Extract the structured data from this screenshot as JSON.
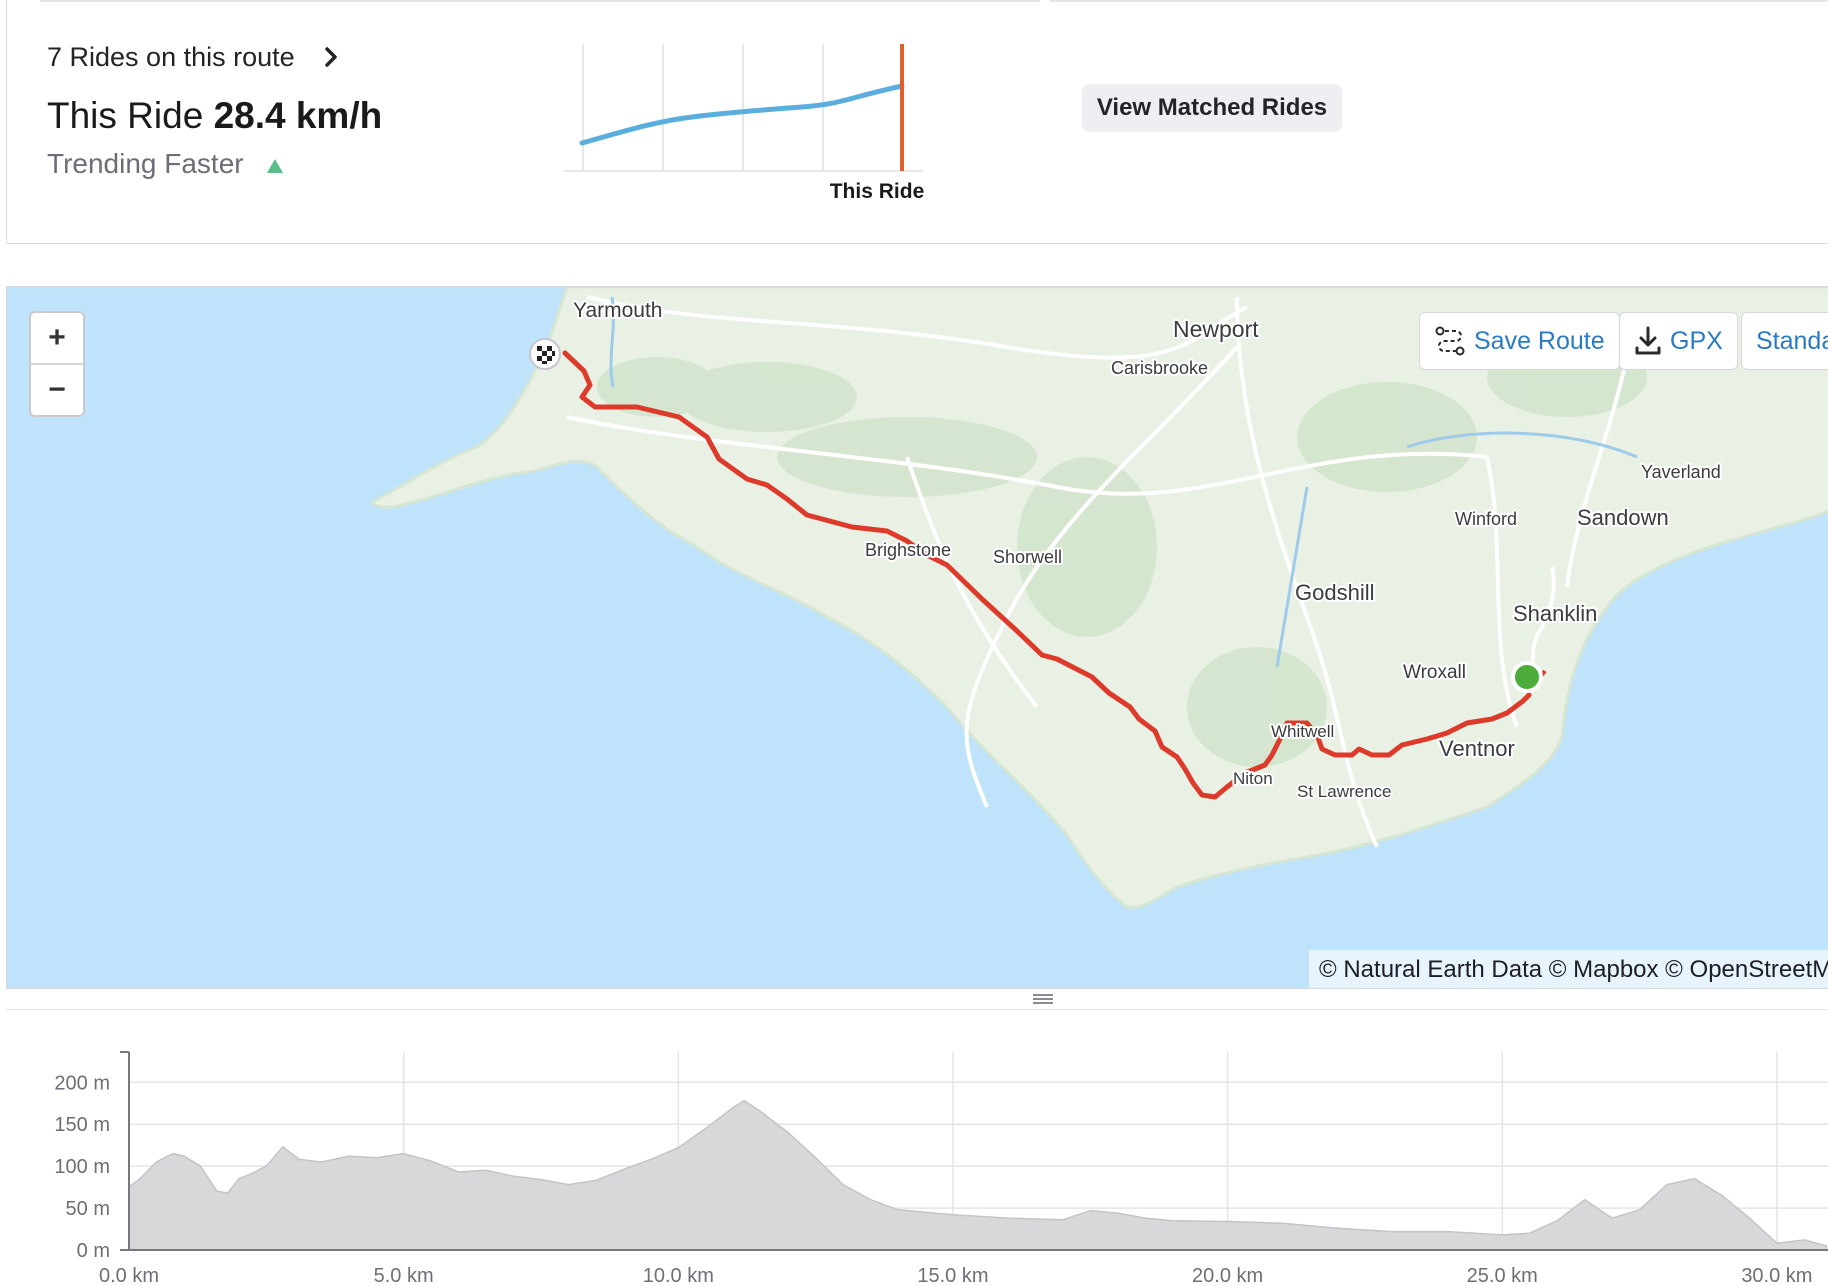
{
  "stats": {
    "rides_on_route": "7 Rides on this route",
    "this_ride_label": "This Ride",
    "this_ride_speed": "28.4 km/h",
    "trend_text": "Trending Faster",
    "trend_chart_label": "This Ride",
    "matched_button": "View Matched Rides",
    "trend_line_color": "#5aaede",
    "this_ride_marker_color": "#e0602b",
    "trend_up_color": "#5cbf8a"
  },
  "map": {
    "zoom_in": "+",
    "zoom_out": "−",
    "save_route": "Save Route",
    "gpx": "GPX",
    "standard": "Standard",
    "attribution": "© Natural Earth Data © Mapbox © OpenStreetMap",
    "route_color": "#de3a2c",
    "start_marker_color": "#4cad3a",
    "water_color": "#bfe3fa",
    "land_color": "#e8f1e4",
    "places": {
      "yarmouth": "Yarmouth",
      "newport": "Newport",
      "carisbrooke": "Carisbrooke",
      "yaverland": "Yaverland",
      "winford": "Winford",
      "sandown": "Sandown",
      "brighstone": "Brighstone",
      "shorwell": "Shorwell",
      "godshill": "Godshill",
      "shanklin": "Shanklin",
      "wroxall": "Wroxall",
      "whitwell": "Whitwell",
      "ventnor": "Ventnor",
      "niton": "Niton",
      "st_lawrence": "St Lawrence"
    }
  },
  "elevation": {
    "y_ticks": [
      "200 m",
      "150 m",
      "100 m",
      "50 m",
      "0 m"
    ],
    "x_ticks": [
      "0.0 km",
      "5.0 km",
      "10.0 km",
      "15.0 km",
      "20.0 km",
      "25.0 km",
      "30.0 km"
    ]
  },
  "chart_data": {
    "type": "area",
    "xlabel": "",
    "ylabel": "",
    "xlim": [
      0,
      30.9
    ],
    "ylim": [
      0,
      200
    ],
    "grid": true,
    "series": [
      {
        "x": [
          0,
          0.2,
          0.5,
          0.8,
          1.0,
          1.3,
          1.6,
          1.8,
          2.0,
          2.2,
          2.5,
          2.8,
          3.1,
          3.5,
          4.0,
          4.5,
          5.0,
          5.5,
          6.0,
          6.5,
          7.0,
          7.5,
          8.0,
          8.5,
          9.0,
          9.5,
          10.0,
          10.5,
          11.0,
          11.2,
          11.5,
          12.0,
          12.5,
          13.0,
          13.5,
          14.0,
          15.0,
          16.0,
          17.0,
          17.5,
          18.0,
          18.5,
          19.0,
          20.0,
          21.0,
          22.0,
          23.0,
          24.0,
          25.0,
          25.5,
          26.0,
          26.5,
          27.0,
          27.5,
          28.0,
          28.5,
          29.0,
          29.5,
          30.0,
          30.5,
          30.9
        ],
        "y": [
          75,
          85,
          105,
          115,
          112,
          100,
          70,
          68,
          85,
          90,
          100,
          123,
          108,
          105,
          112,
          110,
          115,
          106,
          93,
          95,
          88,
          84,
          78,
          83,
          96,
          108,
          122,
          145,
          170,
          178,
          165,
          140,
          110,
          78,
          60,
          48,
          42,
          38,
          36,
          47,
          44,
          38,
          35,
          34,
          32,
          26,
          22,
          22,
          18,
          20,
          35,
          60,
          38,
          48,
          78,
          85,
          65,
          38,
          8,
          12,
          5
        ]
      }
    ]
  }
}
